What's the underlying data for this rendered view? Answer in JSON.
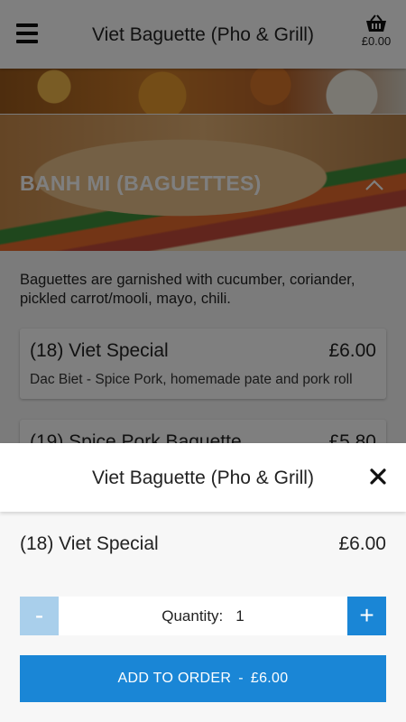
{
  "header": {
    "title": "Viet Baguette (Pho & Grill)",
    "cart_total": "£0.00",
    "menu_icon": "hamburger-menu-icon",
    "cart_icon": "basket-icon"
  },
  "section": {
    "title": "BANH MI (BAGUETTES)",
    "description": "Baguettes are garnished with cucumber, coriander, pickled carrot/mooli, mayo, chili."
  },
  "menu_items": [
    {
      "name": "(18) Viet Special",
      "price": "£6.00",
      "description": "Dac Biet - Spice Pork, homemade pate and pork roll"
    },
    {
      "name": "(19) Spice Pork Baguette",
      "price": "£5.80"
    }
  ],
  "modal": {
    "title": "Viet Baguette (Pho & Grill)",
    "item_name": "(18) Viet Special",
    "item_price": "£6.00",
    "quantity_label": "Quantity:",
    "quantity_value": "1",
    "minus_label": "-",
    "plus_label": "+",
    "add_button_label": "ADD TO ORDER",
    "add_button_separator": "-",
    "add_button_price": "£6.00"
  },
  "colors": {
    "primary": "#1a86d6",
    "disabled": "#a9cfeb",
    "overlay": "rgba(0,0,0,0.5)"
  }
}
